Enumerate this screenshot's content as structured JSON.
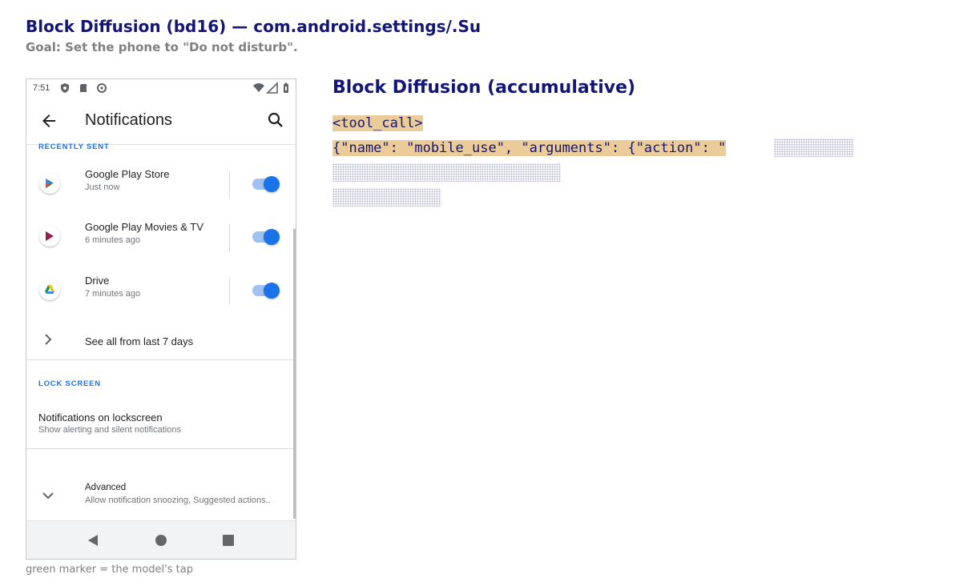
{
  "header": {
    "title": "Block Diffusion (bd16) — com.android.settings/.Su",
    "goal": "Goal: Set the phone to \"Do not disturb\"."
  },
  "phone": {
    "status_bar": {
      "time": "7:51"
    },
    "app_bar": {
      "title": "Notifications"
    },
    "recently_sent": {
      "header": "RECENTLY SENT",
      "apps": [
        {
          "name": "Google Play Store",
          "subtitle": "Just now",
          "enabled": true,
          "icon": "play-store-icon"
        },
        {
          "name": "Google Play Movies & TV",
          "subtitle": "6 minutes ago",
          "enabled": true,
          "icon": "play-movies-icon"
        },
        {
          "name": "Drive",
          "subtitle": "7 minutes ago",
          "enabled": true,
          "icon": "drive-icon"
        }
      ],
      "see_all": "See all from last 7 days"
    },
    "lock_screen": {
      "header": "LOCK SCREEN",
      "item_title": "Notifications on lockscreen",
      "item_subtitle": "Show alerting and silent notifications"
    },
    "advanced": {
      "title": "Advanced",
      "subtitle": "Allow notification snoozing, Suggested actions.."
    }
  },
  "caption": "green marker = the model's tap",
  "panel": {
    "title": "Block Diffusion (accumulative)",
    "line1": "<tool_call>",
    "line2": "{\"name\": \"mobile_use\", \"arguments\": {\"action\": \""
  },
  "colors": {
    "title": "#131676",
    "highlight": "#ebcc98",
    "accent": "#1a73e8"
  }
}
